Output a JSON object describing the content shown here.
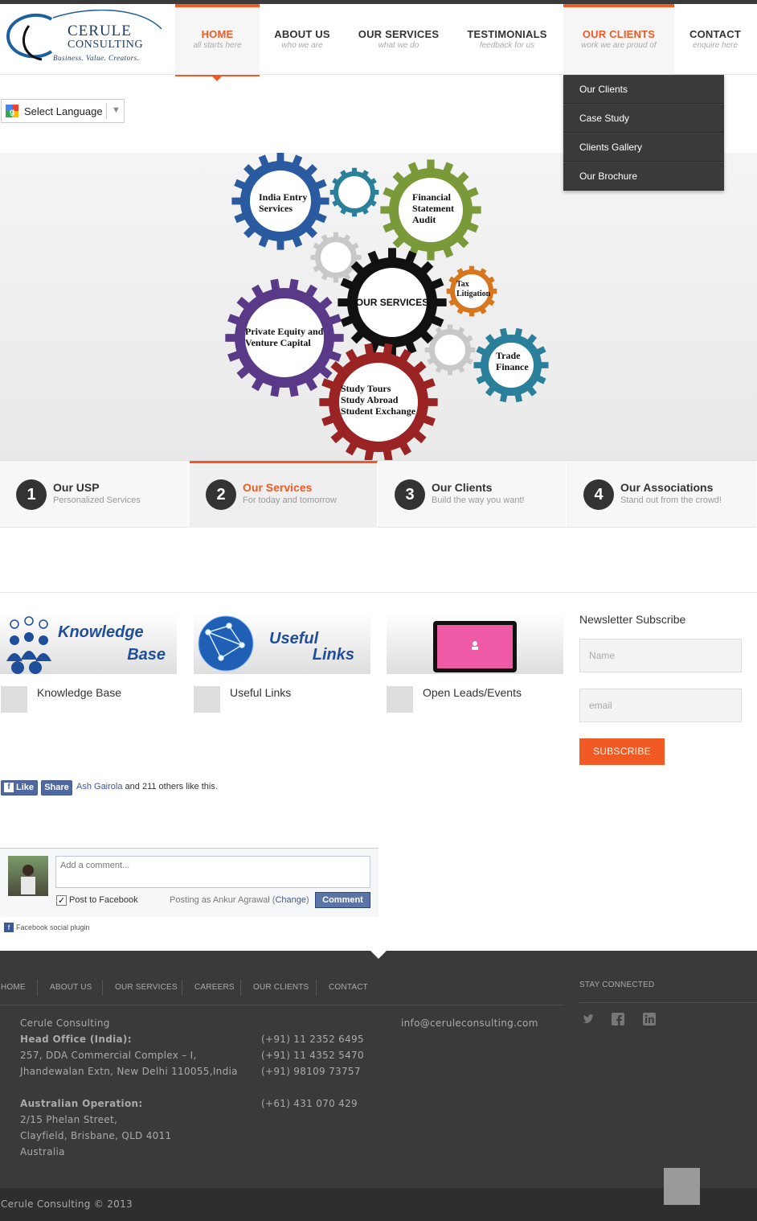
{
  "brand": {
    "name": "CERULE",
    "name2": "CONSULTING",
    "tagline": "Business. Value. Creators."
  },
  "nav": [
    {
      "title": "HOME",
      "subtitle": "all starts here"
    },
    {
      "title": "ABOUT US",
      "subtitle": "who we are"
    },
    {
      "title": "OUR SERVICES",
      "subtitle": "what we do"
    },
    {
      "title": "TESTIMONIALS",
      "subtitle": "feedback for us"
    },
    {
      "title": "OUR CLIENTS",
      "subtitle": "work we are proud of"
    },
    {
      "title": "CONTACT",
      "subtitle": "enquire here"
    }
  ],
  "dropdown": [
    "Our Clients",
    "Case Study",
    "Clients Gallery",
    "Our Brochure"
  ],
  "language": {
    "label": "Select Language"
  },
  "hero": {
    "center": "OUR SERVICES",
    "gears": {
      "india": [
        "India Entry",
        "Services"
      ],
      "audit": [
        "Financial",
        "Statement",
        "Audit"
      ],
      "tax": [
        "Tax",
        "Litigation"
      ],
      "pe": [
        "Private Equity and",
        "Venture Capital"
      ],
      "trade": [
        "Trade",
        "Finance"
      ],
      "study": [
        "Study Tours",
        "Study Abroad",
        "Student Exchange"
      ]
    }
  },
  "tabs": [
    {
      "num": "1",
      "title": "Our USP",
      "subtitle": "Personalized Services"
    },
    {
      "num": "2",
      "title": "Our Services",
      "subtitle": "For today and tomorrow"
    },
    {
      "num": "3",
      "title": "Our Clients",
      "subtitle": "Build the way you want!"
    },
    {
      "num": "4",
      "title": "Our Associations",
      "subtitle": "Stand out from the crowd!"
    }
  ],
  "features": [
    {
      "banner_a": "Knowledge",
      "banner_b": "Base",
      "label": "Knowledge Base"
    },
    {
      "banner_a": "Useful",
      "banner_b": "Links",
      "label": "Useful Links"
    },
    {
      "label": "Open Leads/Events"
    }
  ],
  "newsletter": {
    "title": "Newsletter Subscribe",
    "name_placeholder": "Name",
    "email_placeholder": "email",
    "button": "SUBSCRIBE"
  },
  "facebook": {
    "like": "Like",
    "share": "Share",
    "liker": "Ash Gairola",
    "likes_text": " and 211 others like this.",
    "comment_placeholder": "Add a comment...",
    "post_to_fb": "Post to Facebook",
    "posting_as": "Posting as Ankur Agrawal (",
    "change": "Change",
    "posting_as_end": ")",
    "comment_button": "Comment",
    "plugin": "Facebook social plugin"
  },
  "footer": {
    "nav": [
      "HOME",
      "ABOUT US",
      "OUR SERVICES",
      "CAREERS",
      "OUR CLIENTS",
      "CONTACT"
    ],
    "stay_connected": "STAY CONNECTED",
    "company": "Cerule Consulting",
    "head_office_label": "Head Office (India):",
    "addr1": "257, DDA Commercial Complex – I,",
    "addr2": "Jhandewalan Extn, New Delhi 110055,India",
    "phones": [
      "(+91) 11 2352 6495",
      "(+91) 11 4352 5470",
      "(+91) 98109 73757"
    ],
    "email": "info@ceruleconsulting.com",
    "aus_label": "Australian Operation:",
    "aus_phone": "(+61) 431 070 429",
    "aus_addr": [
      "2/15 Phelan Street,",
      "Clayfield, Brisbane, QLD 4011",
      "Australia"
    ],
    "copyright": "Cerule Consulting © 2013"
  },
  "colors": {
    "accent": "#f15a24",
    "dark": "#3a3a3a",
    "fb": "#4e69a2"
  }
}
